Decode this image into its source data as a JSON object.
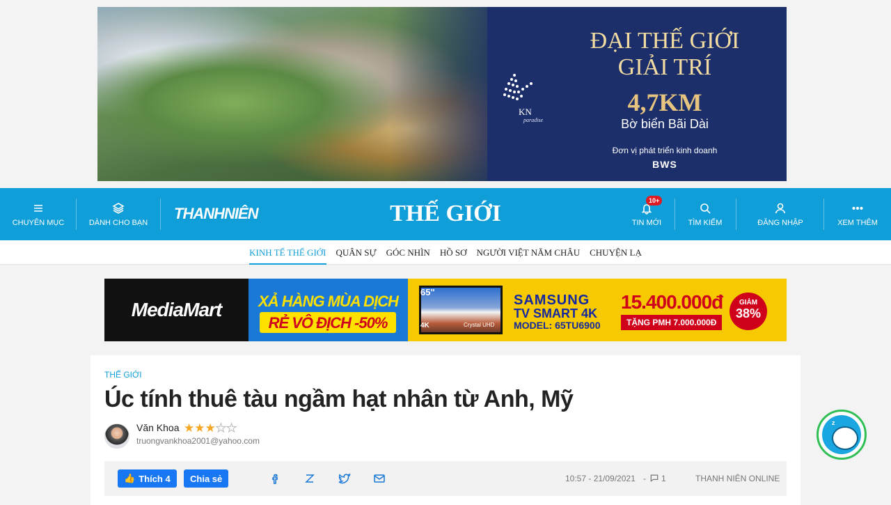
{
  "top_ad": {
    "headline": "ĐẠI THẾ GIỚI GIẢI TRÍ",
    "distance": "4,7KM",
    "beach": "Bờ biển Bãi Dài",
    "developer_label": "Đơn vị phát triển kinh doanh",
    "developer_brand": "BWS",
    "logo_name": "KN",
    "logo_sub": "paradise"
  },
  "header": {
    "menu_label": "CHUYÊN MỤC",
    "for_you_label": "DÀNH CHO BẠN",
    "brand": "THANHNIÊN",
    "section_title": "THẾ GIỚI",
    "news_label": "TIN MỚI",
    "news_badge": "10+",
    "search_label": "TÌM KIẾM",
    "login_label": "ĐĂNG NHẬP",
    "more_label": "XEM THÊM"
  },
  "subnav": {
    "items": [
      {
        "label": "KINH TẾ THẾ GIỚI",
        "active": true
      },
      {
        "label": "QUÂN SỰ"
      },
      {
        "label": "GÓC NHÌN"
      },
      {
        "label": "HỒ SƠ"
      },
      {
        "label": "NGƯỜI VIỆT NĂM CHÂU"
      },
      {
        "label": "CHUYỆN LẠ"
      }
    ]
  },
  "ad2": {
    "store": "MediaMart",
    "promo_line1": "XẢ HÀNG MÙA DỊCH",
    "promo_line2": "RẺ VÔ ĐỊCH -50%",
    "tv_size": "65\"",
    "tv_4k": "4K",
    "tv_crystal": "Crystal UHD",
    "samsung": "SAMSUNG",
    "tv_smart": "TV SMART 4K",
    "model": "MODEL: 65TU6900",
    "price": "15.400.000đ",
    "gift": "TẶNG PMH 7.000.000Đ",
    "discount_label": "GIẢM",
    "discount_value": "38%"
  },
  "article": {
    "category": "THẾ GIỚI",
    "title": "Úc tính thuê tàu ngầm hạt nhân từ Anh, Mỹ",
    "author": "Văn Khoa",
    "author_rating": 3,
    "author_rating_max": 5,
    "author_email": "truongvankhoa2001@yahoo.com",
    "like_label": "Thích 4",
    "share_label": "Chia sẻ",
    "datetime": "10:57 - 21/09/2021",
    "comments_sep": "-",
    "comments": "1",
    "source": "THANH NIÊN ONLINE"
  },
  "colors": {
    "brand_blue": "#0f9ed8",
    "facebook_blue": "#1877f2",
    "star": "#f5a623"
  }
}
